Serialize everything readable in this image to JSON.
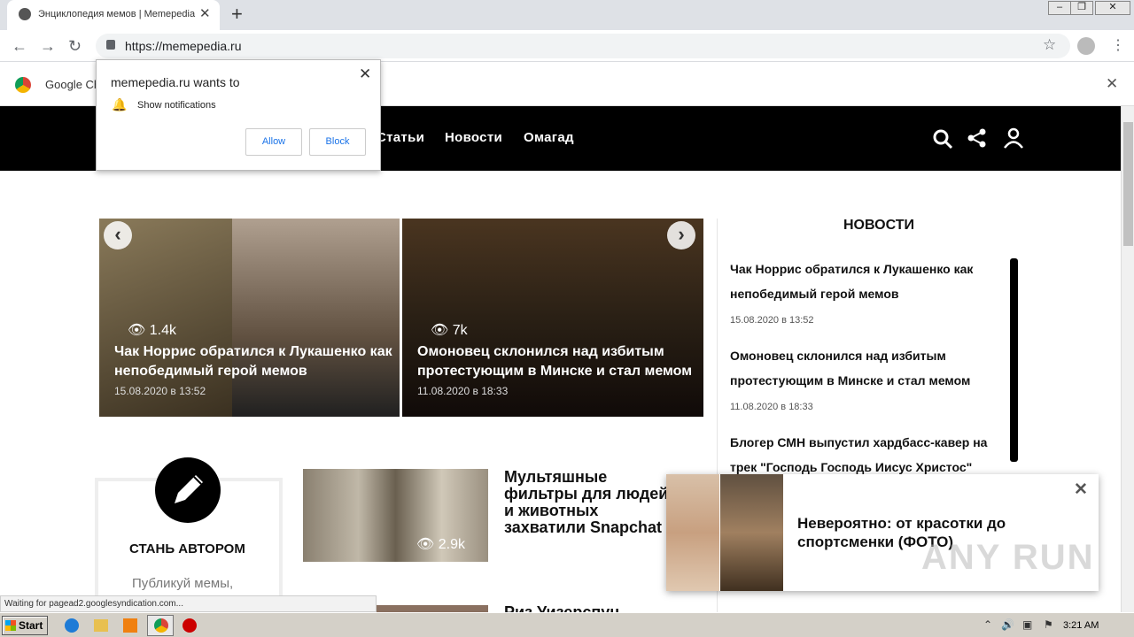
{
  "browser": {
    "tab_title": "Энциклопедия мемов | Memepedia",
    "url": "https://memepedia.ru",
    "infobar_label": "Google Ch"
  },
  "notification": {
    "site": "memepedia.ru wants to",
    "permission": "Show notifications",
    "allow": "Allow",
    "block": "Block"
  },
  "site": {
    "nav": [
      "Статьи",
      "Новости",
      "Омагад"
    ]
  },
  "slider": [
    {
      "views": "1.4k",
      "caption": "Чак Норрис обратился к Лукашенко как непобедимый герой мемов",
      "date": "15.08.2020 в 13:52"
    },
    {
      "views": "7k",
      "caption": "Омоновец склонился над избитым протестующим в Минске и стал мемом",
      "date": "11.08.2020 в 18:33"
    }
  ],
  "news": {
    "heading": "НОВОСТИ",
    "items": [
      {
        "title": "Чак Норрис обратился к Лукашенко как непобедимый герой мемов",
        "date": "15.08.2020 в 13:52"
      },
      {
        "title": "Омоновец склонился над избитым протестующим в Минске и стал мемом",
        "date": "11.08.2020 в 18:33"
      },
      {
        "title": "Блогер СМН выпустил хардбасс-кавер на трек \"Господь Господь Иисус Христос\"",
        "date": ""
      }
    ]
  },
  "author": {
    "title": "СТАНЬ АВТОРОМ",
    "subtitle": "Публикуй мемы,"
  },
  "articles": [
    {
      "views": "2.9k",
      "title": "Мультяшные фильтры для людей и животных захватили Snapchat"
    },
    {
      "title": "Риз Уизерспун"
    }
  ],
  "ad": {
    "text": "Невероятно: от красотки до спортсменки (ФОТО)"
  },
  "watermark": "ANY RUN",
  "status_text": "Waiting for pagead2.googlesyndication.com...",
  "taskbar": {
    "start": "Start",
    "clock": "3:21 AM"
  }
}
